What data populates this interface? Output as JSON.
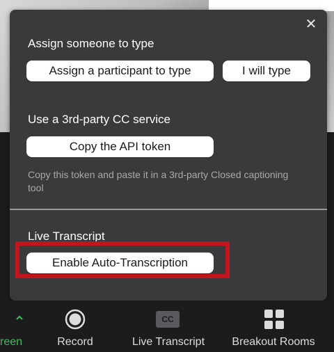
{
  "popup": {
    "assign_title": "Assign someone to type",
    "assign_participant_label": "Assign a participant to type",
    "i_will_type_label": "I will type",
    "third_party_title": "Use a 3rd-party CC service",
    "copy_token_label": "Copy the API token",
    "help_text": "Copy this token and paste it in a 3rd-party Closed captioning tool",
    "live_transcript_title": "Live Transcript",
    "enable_auto_label": "Enable Auto-Transcription",
    "close_icon": "close-icon"
  },
  "toolbar": {
    "items": [
      {
        "label": "reen",
        "icon": "chevron-up-icon",
        "color": "#3fbf5a"
      },
      {
        "label": "Record",
        "icon": "record-icon"
      },
      {
        "label": "Live Transcript",
        "icon": "cc-icon",
        "icon_text": "CC"
      },
      {
        "label": "Breakout Rooms",
        "icon": "breakout-rooms-icon"
      }
    ]
  },
  "colors": {
    "popup_bg": "#3a3a3c",
    "highlight": "#c4151c",
    "toolbar_bg": "#1c1c1e",
    "green_accent": "#3fbf5a"
  }
}
